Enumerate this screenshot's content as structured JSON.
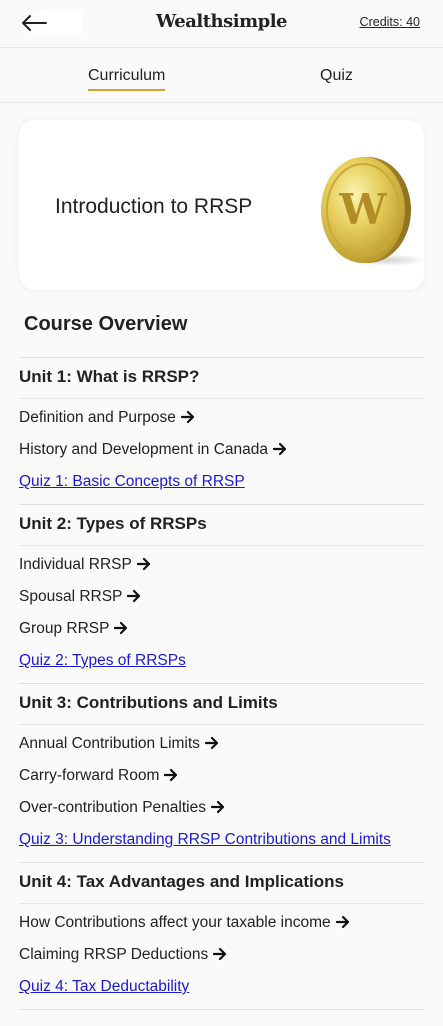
{
  "header": {
    "logo": "Wealthsimple",
    "credits": "Credits: 40",
    "back_icon": "arrow-left-icon"
  },
  "tabs": [
    {
      "label": "Curriculum",
      "active": true
    },
    {
      "label": "Quiz",
      "active": false
    }
  ],
  "hero": {
    "title": "Introduction to RRSP",
    "coin_letter": "W"
  },
  "overview_title": "Course Overview",
  "units": [
    {
      "title": "Unit 1: What is RRSP?",
      "lessons": [
        "Definition and Purpose",
        "History and Development in Canada"
      ],
      "quiz": "Quiz 1: Basic Concepts of RRSP"
    },
    {
      "title": "Unit 2: Types of RRSPs",
      "lessons": [
        "Individual RRSP",
        "Spousal RRSP",
        "Group RRSP"
      ],
      "quiz": "Quiz 2: Types of RRSPs"
    },
    {
      "title": "Unit 3: Contributions and Limits",
      "lessons": [
        "Annual Contribution Limits",
        "Carry-forward Room",
        "Over-contribution Penalties"
      ],
      "quiz": "Quiz 3: Understanding RRSP Contributions and Limits"
    },
    {
      "title": "Unit 4: Tax Advantages and Implications",
      "lessons": [
        "How Contributions affect your taxable income",
        "Claiming RRSP Deductions"
      ],
      "quiz": "Quiz 4: Tax Deductability"
    }
  ],
  "colors": {
    "accent": "#d6a13a",
    "link": "#1a1ad6",
    "text": "#222222",
    "background": "#fafafa"
  }
}
